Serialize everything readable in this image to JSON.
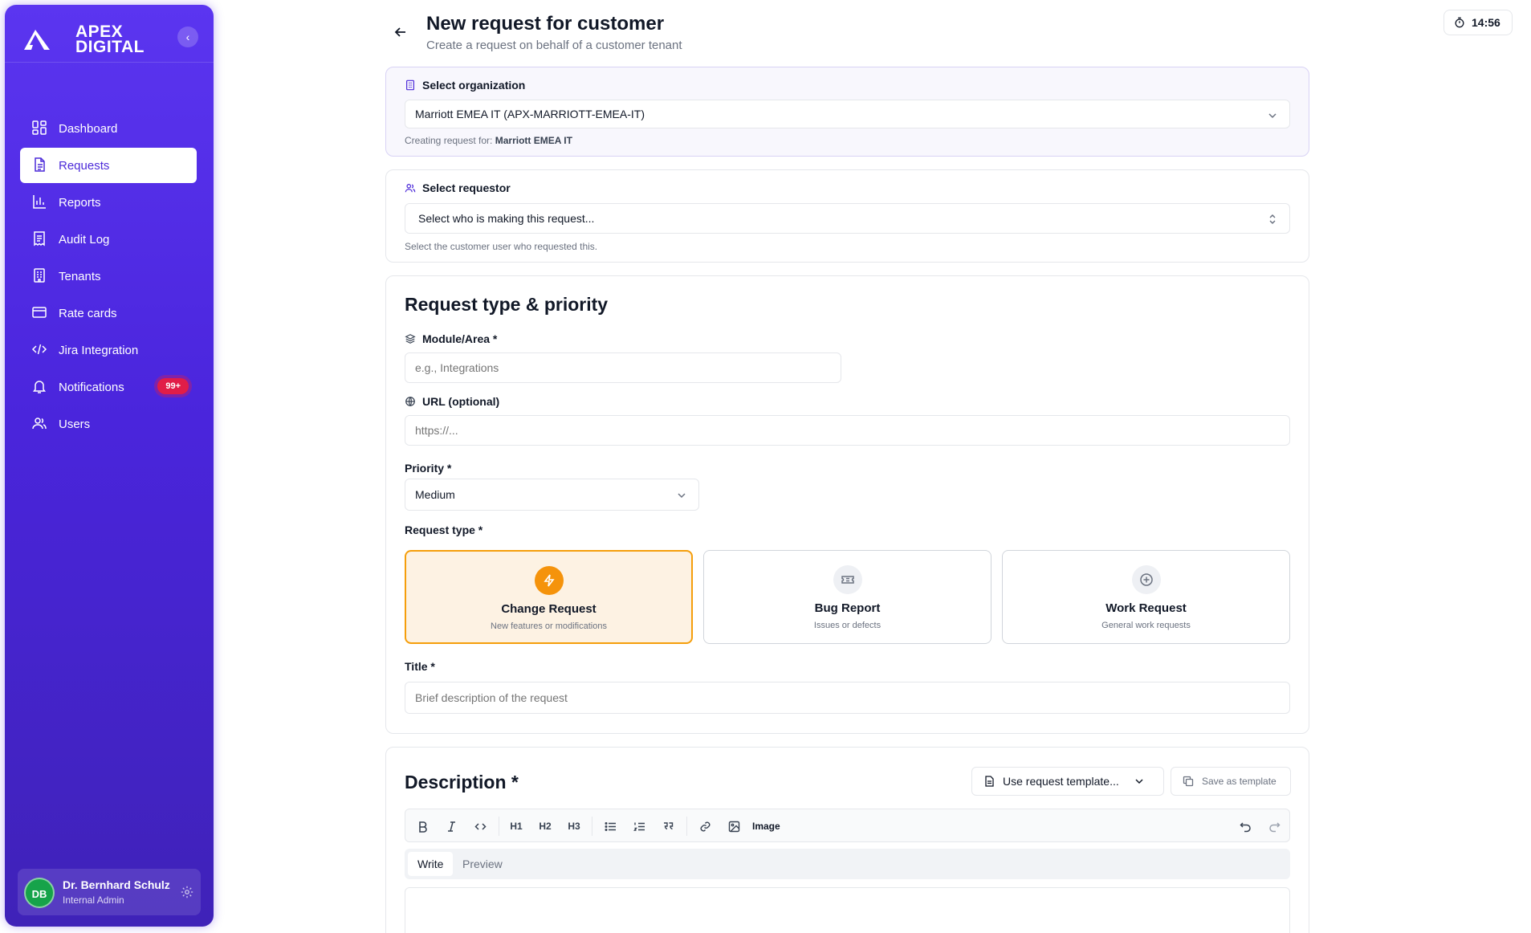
{
  "brand": {
    "line1": "APEX",
    "line2": "DIGITAL"
  },
  "sidebar": {
    "items": [
      {
        "label": "Dashboard",
        "icon": "dashboard-icon"
      },
      {
        "label": "Requests",
        "icon": "document-icon",
        "active": true
      },
      {
        "label": "Reports",
        "icon": "bar-chart-icon"
      },
      {
        "label": "Audit Log",
        "icon": "receipt-icon"
      },
      {
        "label": "Tenants",
        "icon": "building-icon"
      },
      {
        "label": "Rate cards",
        "icon": "credit-card-icon"
      },
      {
        "label": "Jira Integration",
        "icon": "code-icon"
      },
      {
        "label": "Notifications",
        "icon": "bell-icon",
        "badge": "99+"
      },
      {
        "label": "Users",
        "icon": "users-icon"
      }
    ],
    "user": {
      "initials": "DB",
      "name": "Dr. Bernhard Schulz",
      "role": "Internal Admin"
    }
  },
  "header": {
    "title": "New request for customer",
    "subtitle": "Create a request on behalf of a customer tenant",
    "clock": "14:56"
  },
  "organization": {
    "label": "Select organization",
    "value": "Marriott EMEA IT (APX-MARRIOTT-EMEA-IT)",
    "hint_prefix": "Creating request for:",
    "hint_value": "Marriott EMEA IT"
  },
  "requestor": {
    "label": "Select requestor",
    "placeholder": "Select who is making this request...",
    "hint": "Select the customer user who requested this."
  },
  "type_priority": {
    "title": "Request type & priority",
    "module_label": "Module/Area *",
    "module_placeholder": "e.g., Integrations",
    "url_label": "URL (optional)",
    "url_placeholder": "https://...",
    "priority_label": "Priority *",
    "priority_value": "Medium",
    "request_type_label": "Request type *",
    "types": [
      {
        "name": "Change Request",
        "desc": "New features or modifications",
        "icon": "bolt-icon",
        "selected": true
      },
      {
        "name": "Bug Report",
        "desc": "Issues or defects",
        "icon": "ticket-icon",
        "selected": false
      },
      {
        "name": "Work Request",
        "desc": "General work requests",
        "icon": "plus-circle-icon",
        "selected": false
      }
    ],
    "title_label": "Title *",
    "title_placeholder": "Brief description of the request"
  },
  "description": {
    "title": "Description *",
    "template_button": "Use request template...",
    "save_template_button": "Save as template",
    "toolbar": {
      "h1": "H1",
      "h2": "H2",
      "h3": "H3",
      "image": "Image"
    },
    "tabs": [
      "Write",
      "Preview"
    ]
  },
  "colors": {
    "sidebar": "#4a25dc",
    "accent": "#f59e0b",
    "badge": "#e11d48"
  }
}
